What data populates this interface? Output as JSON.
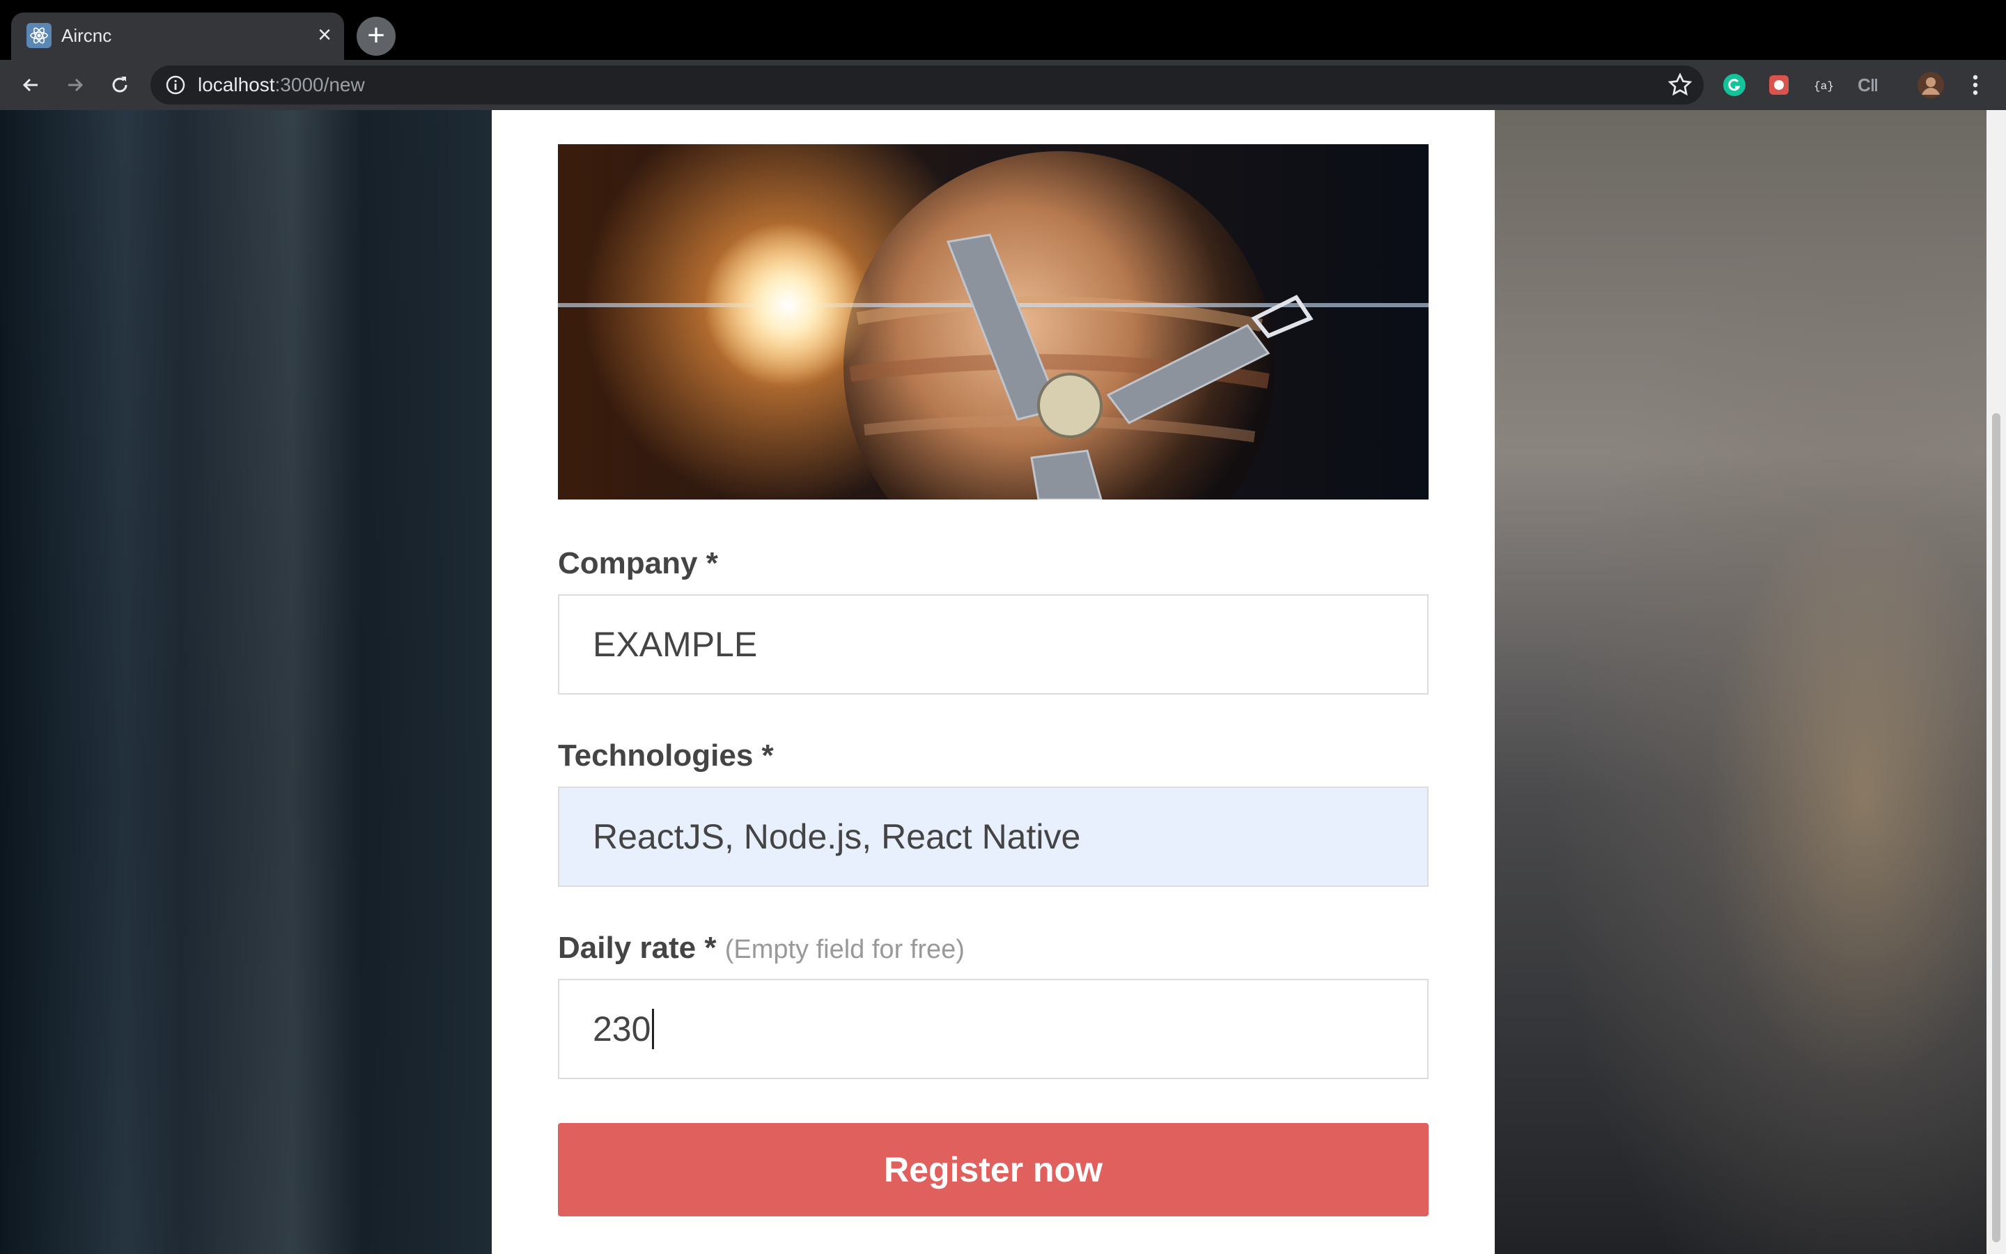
{
  "browser": {
    "tab": {
      "title": "Aircnc"
    },
    "address": {
      "host": "localhost",
      "path": ":3000/new"
    }
  },
  "form": {
    "thumbnail_alt": "",
    "company": {
      "label": "Company *",
      "value": "EXAMPLE"
    },
    "technologies": {
      "label": "Technologies *",
      "value": "ReactJS, Node.js, React Native"
    },
    "price": {
      "label": "Daily rate *",
      "hint": "(Empty field for free)",
      "value": "230"
    },
    "submit_label": "Register now"
  },
  "colors": {
    "accent": "#e0605e",
    "autofill": "#e8f0fe",
    "label": "#444444"
  }
}
